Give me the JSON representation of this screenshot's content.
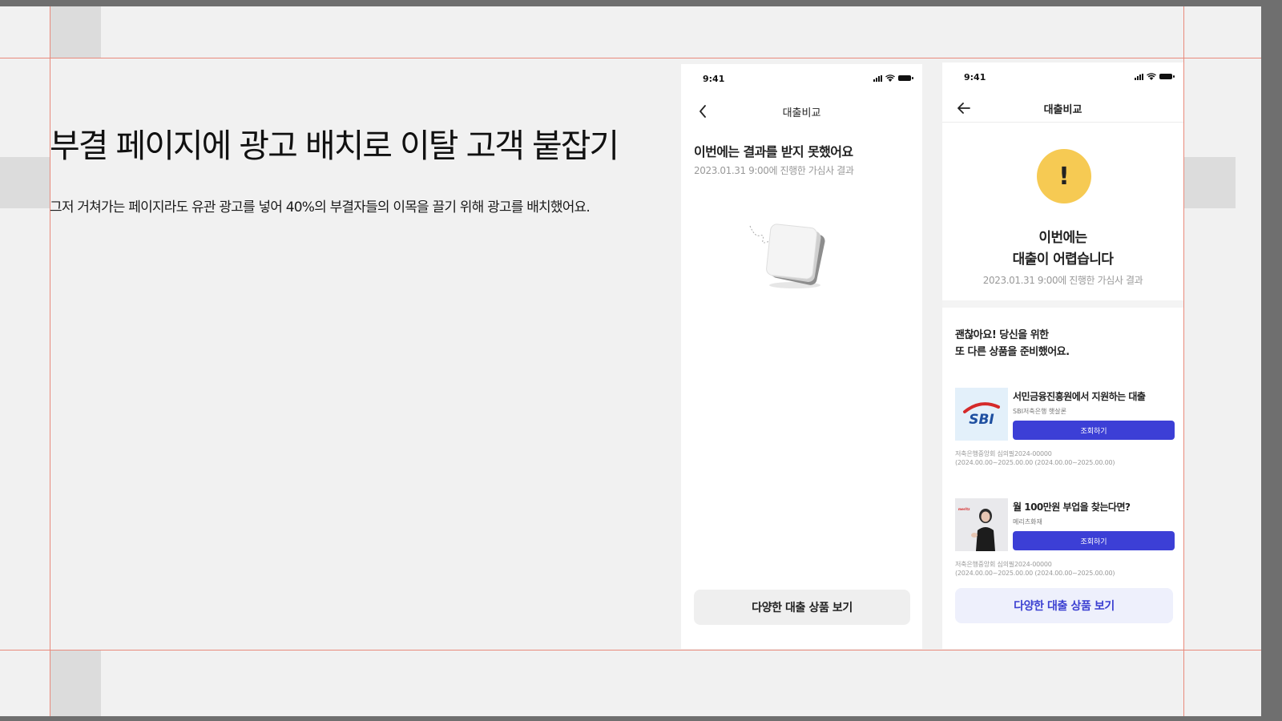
{
  "slide": {
    "headline": "부결 페이지에 광고 배치로 이탈 고객 붙잡기",
    "subtext": "그저 거쳐가는 페이지라도 유관 광고를 넣어 40%의 부결자들의 이목을 끌기 위해 광고를 배치했어요."
  },
  "phone_before": {
    "status_time": "9:41",
    "nav_title": "대출비교",
    "result_title": "이번에는 결과를 받지 못했어요",
    "result_date": "2023.01.31 9:00에 진행한 가심사 결과",
    "cta_label": "다양한 대출 상품 보기"
  },
  "phone_after": {
    "status_time": "9:41",
    "nav_title": "대출비교",
    "warning_symbol": "!",
    "result_title_line1": "이번에는",
    "result_title_line2": "대출이 어렵습니다",
    "result_date": "2023.01.31 9:00에 진행한 가심사 결과",
    "section_line1": "괜찮아요! 당신을 위한",
    "section_line2": "또 다른 상품을 준비했어요.",
    "products": [
      {
        "logo_text": "SBI",
        "name": "서민금융진흥원에서 지원하는 대출",
        "provider": "SBI저축은행 햇살론",
        "button_label": "조회하기",
        "legal_line1": "저축은행중앙회 심의필2024-00000",
        "legal_line2": "(2024.00.00~2025.00.00 (2024.00.00~2025.00.00)"
      },
      {
        "logo_text": "meritz",
        "name": "월 100만원 부업을 찾는다면?",
        "provider": "메리츠화재",
        "button_label": "조회하기",
        "legal_line1": "저축은행중앙회 심의필2024-00000",
        "legal_line2": "(2024.00.00~2025.00.00 (2024.00.00~2025.00.00)"
      }
    ],
    "cta_label": "다양한 대출 상품 보기"
  },
  "colors": {
    "guide_line": "#e88a7c",
    "primary_button": "#3c3fd6",
    "warning": "#f6ca53",
    "cta_tint": "#eef0fc"
  },
  "icons": [
    "back-chevron-icon",
    "back-arrow-icon",
    "signal-icon",
    "wifi-icon",
    "battery-icon",
    "warning-icon",
    "note-pad-illustration"
  ]
}
